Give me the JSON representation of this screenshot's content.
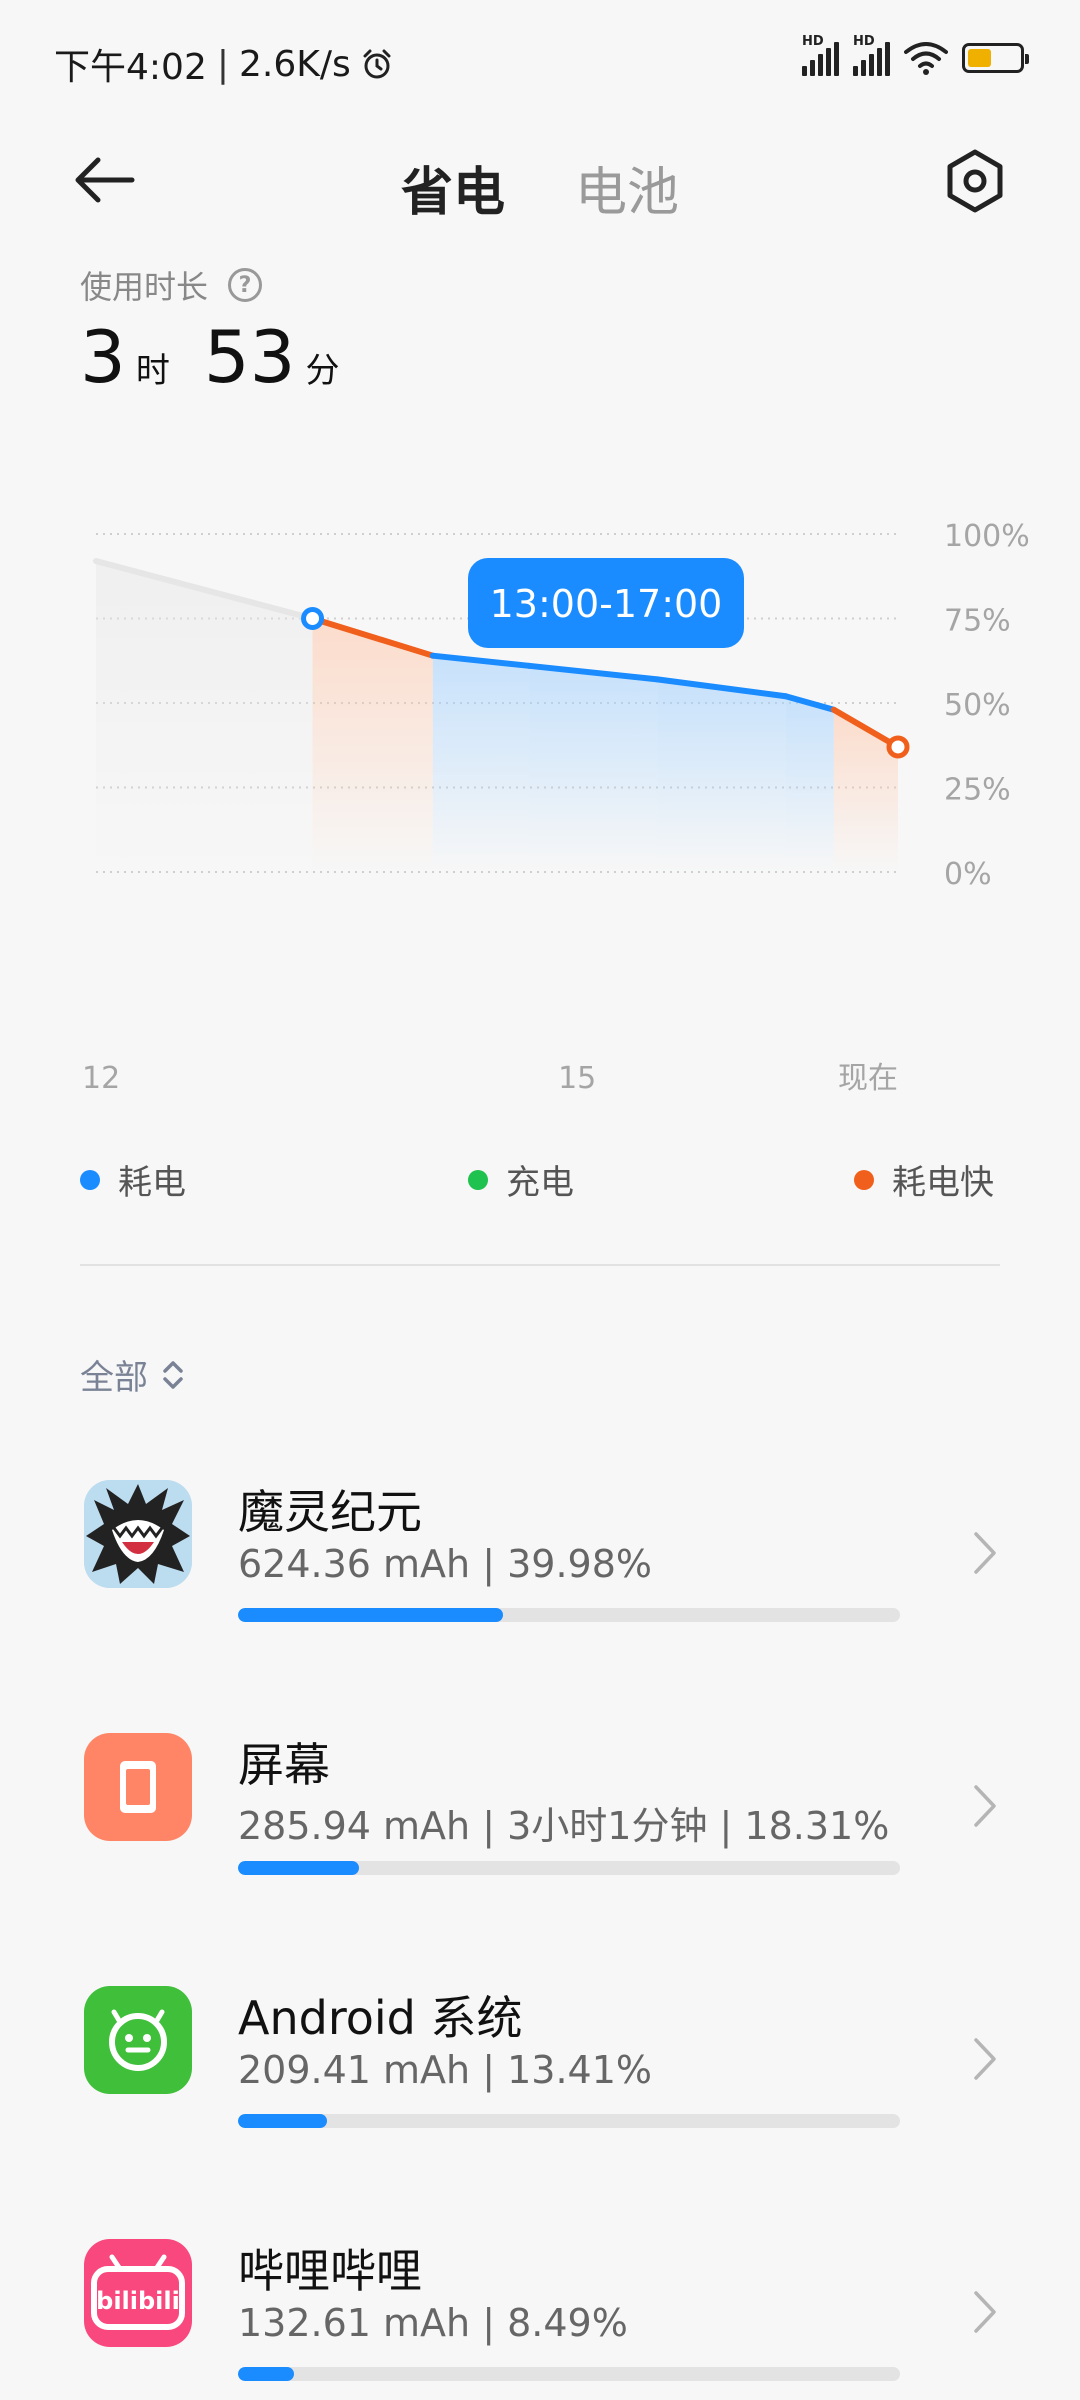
{
  "status_bar": {
    "time": "下午4:02",
    "speed": "2.6K/s",
    "sim_label": "HD",
    "battery_level": 0.45,
    "battery_color": "#f0b000"
  },
  "header": {
    "tab_power_saving": "省电",
    "tab_battery": "电池"
  },
  "usage": {
    "label": "使用时长",
    "hours": "3",
    "hours_unit": "时",
    "minutes": "53",
    "minutes_unit": "分"
  },
  "chart_data": {
    "type": "line",
    "x_ticks": [
      "12",
      "15",
      "现在"
    ],
    "y_ticks": [
      "100%",
      "75%",
      "50%",
      "25%",
      "0%"
    ],
    "ylim": [
      0,
      100
    ],
    "tooltip": "13:00-17:00",
    "series": [
      {
        "points": [
          {
            "x": 12.0,
            "y": 92
          },
          {
            "x": 13.35,
            "y": 75
          },
          {
            "x": 14.1,
            "y": 64
          },
          {
            "x": 14.7,
            "y": 61
          },
          {
            "x": 15.5,
            "y": 57
          },
          {
            "x": 16.3,
            "y": 52
          },
          {
            "x": 16.6,
            "y": 48
          },
          {
            "x": 17.0,
            "y": 37
          }
        ]
      }
    ],
    "colors": {
      "normal": "#1a8cff",
      "charging": "#1fc14f",
      "fast": "#f0601c"
    }
  },
  "legend": {
    "normal": "耗电",
    "charging": "充电",
    "fast": "耗电快"
  },
  "filter": {
    "label": "全部"
  },
  "apps": [
    {
      "name": "魔灵纪元",
      "detail": "624.36 mAh | 39.98%",
      "fraction": 0.3998,
      "icon": "game-icon"
    },
    {
      "name": "屏幕",
      "detail": "285.94 mAh | 3小时1分钟 | 18.31%",
      "fraction": 0.1831,
      "icon": "screen-icon"
    },
    {
      "name": "Android 系统",
      "detail": "209.41 mAh | 13.41%",
      "fraction": 0.1341,
      "icon": "android-icon"
    },
    {
      "name": "哔哩哔哩",
      "detail": "132.61 mAh | 8.49%",
      "fraction": 0.0849,
      "icon": "bilibili-icon"
    }
  ]
}
